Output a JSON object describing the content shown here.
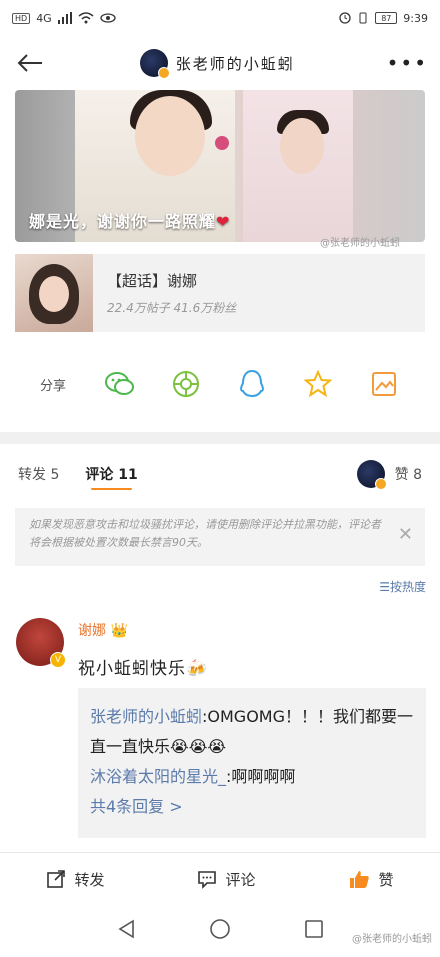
{
  "status": {
    "time": "9:39",
    "network": "4G",
    "battery": "87"
  },
  "header": {
    "title": "张老师的小蚯蚓"
  },
  "hero": {
    "caption": "娜是光，谢谢你一路照耀",
    "watermark": "@张老师的小蚯蚓"
  },
  "topic": {
    "name": "【超话】谢娜",
    "stats": "22.4万帖子  41.6万粉丝"
  },
  "share": {
    "label": "分享",
    "icons": [
      "wechat-icon",
      "moments-icon",
      "qq-icon",
      "favorite-icon",
      "image-save-icon"
    ]
  },
  "tabs": {
    "repost": "转发 5",
    "comment": "评论 11",
    "like": "赞 8"
  },
  "notice": {
    "text": "如果发现恶意攻击和垃圾骚扰评论，请使用删除评论并拉黑功能，评论者将会根据被处置次数最长禁言90天。"
  },
  "sort": {
    "label": "按热度"
  },
  "comment": {
    "author": "谢娜",
    "text": "祝小蚯蚓快乐🍻",
    "replies": [
      {
        "name": "张老师的小蚯蚓",
        "text": ":OMGOMG！！！我们都要一直一直快乐😭😭😭"
      },
      {
        "name": "沐浴着太阳的星光_",
        "text": ":啊啊啊啊"
      }
    ],
    "more": "共4条回复 >"
  },
  "actions": {
    "repost": "转发",
    "comment": "评论",
    "like": "赞"
  },
  "watermark_bottom": "@张老师的小蚯蚓",
  "colors": {
    "accent": "#f78b1f",
    "link": "#5b7bab",
    "author": "#e8752d",
    "heart": "#e0223a"
  }
}
